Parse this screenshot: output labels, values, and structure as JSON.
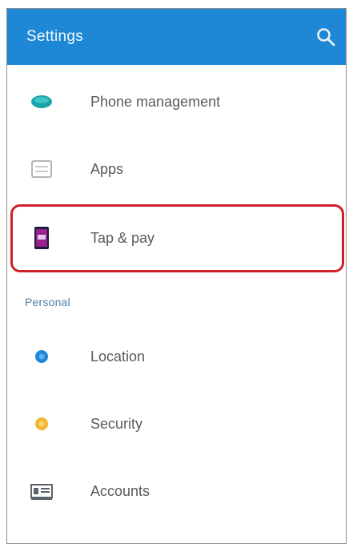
{
  "appbar": {
    "title": "Settings",
    "background": "#1e88d6",
    "search_icon": "search-icon"
  },
  "rows_top": [
    {
      "label": "Phone management",
      "icon": "phone-management-icon",
      "icon_color": "#1aa3a8"
    },
    {
      "label": "Apps",
      "icon": "apps-icon",
      "icon_color": "#b5b5b5"
    },
    {
      "label": "Tap & pay",
      "icon": "tap-and-pay-icon",
      "icon_color": "#9c1f8f"
    }
  ],
  "section": {
    "header": "Personal"
  },
  "rows_personal": [
    {
      "label": "Location",
      "icon": "location-icon",
      "icon_color": "#1e88d6"
    },
    {
      "label": "Security",
      "icon": "security-icon",
      "icon_color": "#f2b630"
    },
    {
      "label": "Accounts",
      "icon": "accounts-icon",
      "icon_color": "#5a6470"
    }
  ],
  "highlight_color": "#d0202a"
}
